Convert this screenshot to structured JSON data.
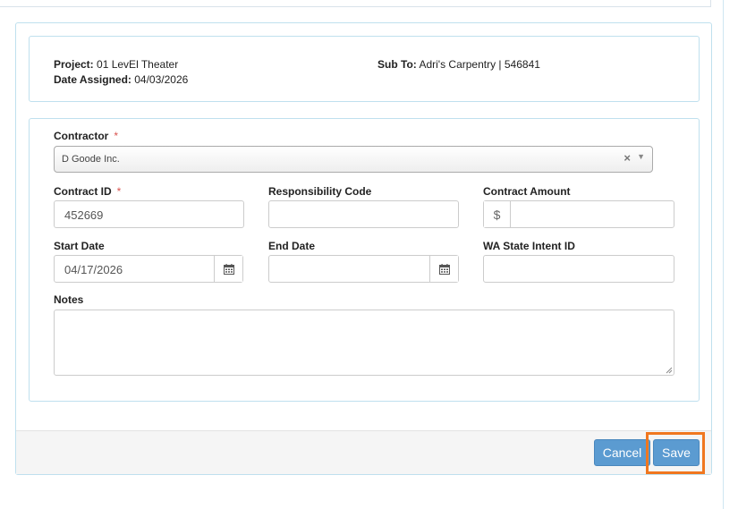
{
  "assignment": {
    "project_label": "Project:",
    "project_value": "01 LevEl Theater",
    "date_assigned_label": "Date Assigned:",
    "date_assigned_value": "04/03/2026",
    "sub_to_label": "Sub To:",
    "sub_to_value": "Adri's Carpentry | 546841"
  },
  "form": {
    "contractor": {
      "label": "Contractor",
      "required_mark": "*",
      "value": "D Goode Inc.",
      "clear_glyph": "×",
      "caret_glyph": "▼"
    },
    "contract_id": {
      "label": "Contract ID",
      "required_mark": "*",
      "value": "452669"
    },
    "responsibility_code": {
      "label": "Responsibility Code",
      "value": ""
    },
    "contract_amount": {
      "label": "Contract Amount",
      "currency_symbol": "$",
      "value": ""
    },
    "start_date": {
      "label": "Start Date",
      "value": "04/17/2026",
      "icon": "calendar-icon"
    },
    "end_date": {
      "label": "End Date",
      "value": "",
      "icon": "calendar-icon"
    },
    "wa_state_intent_id": {
      "label": "WA State Intent ID",
      "value": ""
    },
    "notes": {
      "label": "Notes",
      "value": ""
    }
  },
  "footer": {
    "cancel_label": "Cancel",
    "save_label": "Save"
  },
  "colors": {
    "button_blue": "#5b9bd1",
    "highlight_orange": "#f0771f",
    "required_red": "#d9534f",
    "panel_border": "#bfe0ee"
  }
}
